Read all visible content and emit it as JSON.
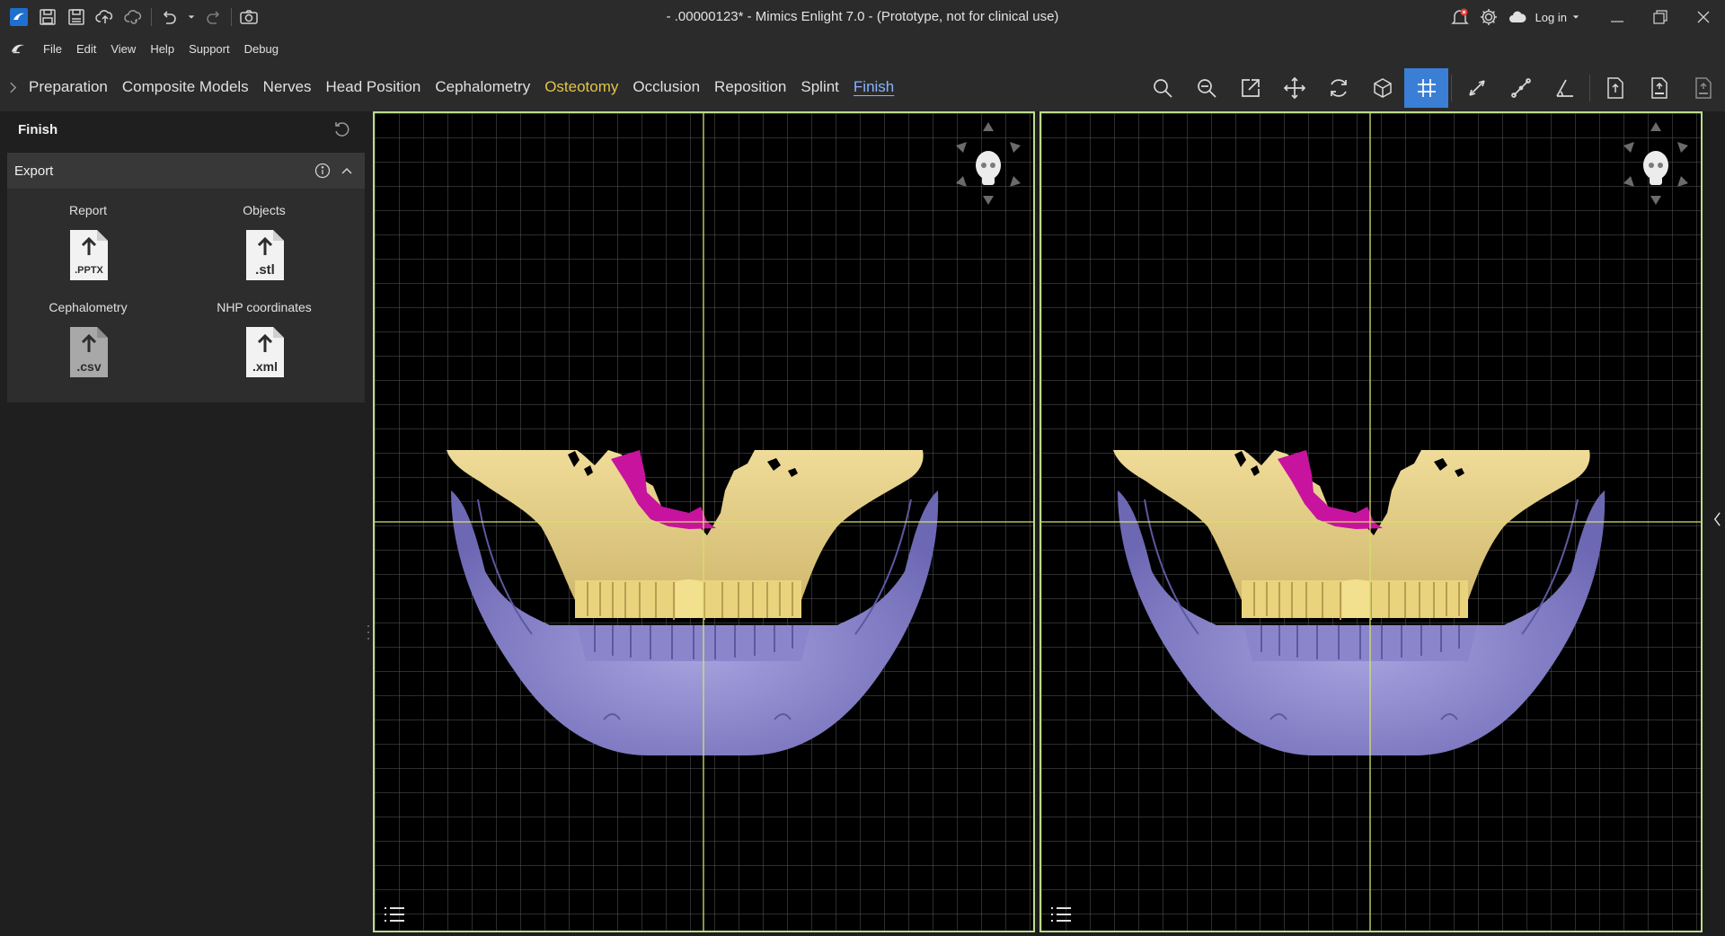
{
  "window": {
    "title": "- .00000123* - Mimics Enlight 7.0  - (Prototype, not for clinical use)",
    "login_label": "Log in",
    "notification_badge_color": "#e53935"
  },
  "menu": {
    "items": [
      "File",
      "Edit",
      "View",
      "Help",
      "Support",
      "Debug"
    ]
  },
  "workflow": {
    "steps": [
      "Preparation",
      "Composite Models",
      "Nerves",
      "Head Position",
      "Cephalometry",
      "Osteotomy",
      "Occlusion",
      "Reposition",
      "Splint",
      "Finish"
    ],
    "highlight_step": "Osteotomy",
    "active_step": "Finish"
  },
  "toolbar": {
    "tools": [
      "zoom-in-icon",
      "zoom-out-icon",
      "open-external-icon",
      "pan-icon",
      "rotate-icon",
      "view-3d-icon",
      "grid-icon",
      "measure-distance-icon",
      "measure-line-icon",
      "measure-angle-icon",
      "export-file-icon",
      "export-stl-icon",
      "export-csv-icon"
    ],
    "active_tool": "grid-icon"
  },
  "panel": {
    "title": "Finish",
    "section_title": "Export",
    "export_items": [
      {
        "label": "Report",
        "file_ext": ".PPTX"
      },
      {
        "label": "Objects",
        "file_ext": ".stl"
      },
      {
        "label": "Cephalometry",
        "file_ext": ".csv"
      },
      {
        "label": "NHP coordinates",
        "file_ext": ".xml"
      }
    ]
  },
  "viewports": {
    "count": 2,
    "border_color": "#bddc8c",
    "crosshair_color": "#d6df6e",
    "colors": {
      "maxilla": "#e8d289",
      "mandible": "#8b86cc",
      "segment": "#c8139f"
    }
  }
}
